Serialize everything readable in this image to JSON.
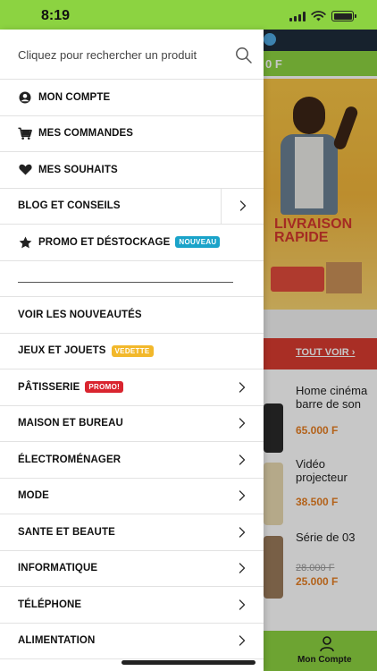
{
  "status_bar": {
    "time": "8:19"
  },
  "search": {
    "placeholder": "Cliquez pour rechercher un produit"
  },
  "menu": {
    "items": [
      {
        "name": "menu-item-mon-compte",
        "label": "MON COMPTE",
        "icon": "user-circle-icon"
      },
      {
        "name": "menu-item-mes-commandes",
        "label": "MES COMMANDES",
        "icon": "cart-icon"
      },
      {
        "name": "menu-item-mes-souhaits",
        "label": "MES SOUHAITS",
        "icon": "heart-icon"
      },
      {
        "name": "menu-item-blog-et-conseils",
        "label": "BLOG ET CONSEILS",
        "chevron": true,
        "split": true
      },
      {
        "name": "menu-item-promo-et-destockage",
        "label": "PROMO ET DÉSTOCKAGE",
        "icon": "star-icon",
        "badge": "NOUVEAU",
        "badge_color": "#1aa3c9"
      },
      {
        "name": "divider",
        "divider": true
      },
      {
        "name": "menu-item-voir-les-nouveautes",
        "label": "VOIR LES NOUVEAUTÉS"
      },
      {
        "name": "menu-item-jeux-et-jouets",
        "label": "JEUX ET JOUETS",
        "badge": "VEDETTE",
        "badge_color": "#f2b82b"
      },
      {
        "name": "menu-item-patisserie",
        "label": "PÂTISSERIE",
        "badge": "PROMO!",
        "badge_color": "#d9252f",
        "chevron": true
      },
      {
        "name": "menu-item-maison-et-bureau",
        "label": "MAISON ET BUREAU",
        "chevron": true
      },
      {
        "name": "menu-item-electromenager",
        "label": "ÉLECTROMÉNAGER",
        "chevron": true
      },
      {
        "name": "menu-item-mode",
        "label": "MODE",
        "chevron": true
      },
      {
        "name": "menu-item-sante-et-beaute",
        "label": "SANTE ET BEAUTE",
        "chevron": true
      },
      {
        "name": "menu-item-informatique",
        "label": "INFORMATIQUE",
        "chevron": true
      },
      {
        "name": "menu-item-telephone",
        "label": "TÉLÉPHONE",
        "chevron": true
      },
      {
        "name": "menu-item-alimentation",
        "label": "ALIMENTATION",
        "chevron": true
      }
    ]
  },
  "background": {
    "header_price": "0 F",
    "banner_text": "LIVRAISON RAPIDE",
    "see_all": "TOUT VOIR ›",
    "products": [
      {
        "name": "Home cinéma barre de son",
        "price": "65.000 F"
      },
      {
        "name": "Vidéo projecteur",
        "price": "38.500 F"
      },
      {
        "name": "Série de 03",
        "old_price": "28.000 F",
        "price": "25.000 F"
      }
    ],
    "bottom_nav_label": "Mon Compte"
  },
  "colors": {
    "accent_green": "#8cd341",
    "promo_red": "#d9252f",
    "new_blue": "#1aa3c9",
    "featured_yellow": "#f2b82b",
    "price_orange": "#e67e22"
  }
}
